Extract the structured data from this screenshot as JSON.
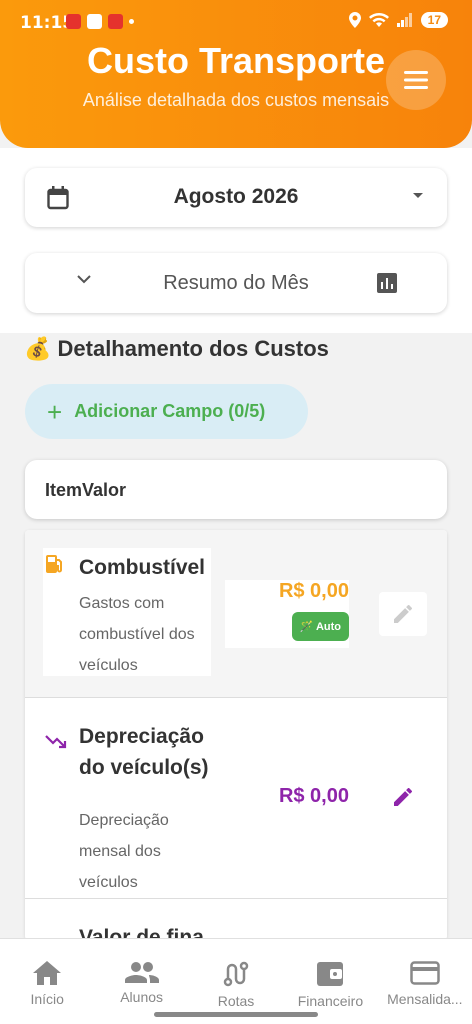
{
  "status": {
    "time": "11:15",
    "battery": "17"
  },
  "header": {
    "title": "Custo Transporte",
    "subtitle": "Análise detalhada dos custos mensais"
  },
  "month_select": {
    "value": "Agosto 2026"
  },
  "summary": {
    "label": "Resumo do Mês"
  },
  "section": {
    "title": "💰 Detalhamento dos Custos"
  },
  "add_button": {
    "plus": "+",
    "label": "Adicionar Campo (0/5)"
  },
  "table": {
    "header": "ItemValor"
  },
  "items": [
    {
      "name": "Combustível",
      "description": "Gastos com combustível dos veículos",
      "value": "R$ 0,00",
      "badge": "Auto",
      "value_color": "#f5a623",
      "icon": "fuel-icon"
    },
    {
      "name": "Depreciação do veículo(s)",
      "description": "Depreciação mensal dos veículos",
      "value": "R$ 0,00",
      "value_color": "#8e24aa",
      "icon": "trending-down-icon"
    },
    {
      "name": "Valor de fina",
      "icon": "finance-icon"
    }
  ],
  "nav": [
    {
      "label": "Início",
      "icon": "home-icon"
    },
    {
      "label": "Alunos",
      "icon": "people-icon"
    },
    {
      "label": "Rotas",
      "icon": "route-icon"
    },
    {
      "label": "Financeiro",
      "icon": "wallet-icon"
    },
    {
      "label": "Mensalida...",
      "icon": "card-icon"
    }
  ],
  "colors": {
    "header": "#f7830b",
    "green": "#4caf50",
    "purple": "#8e24aa",
    "orange": "#f5a623"
  }
}
